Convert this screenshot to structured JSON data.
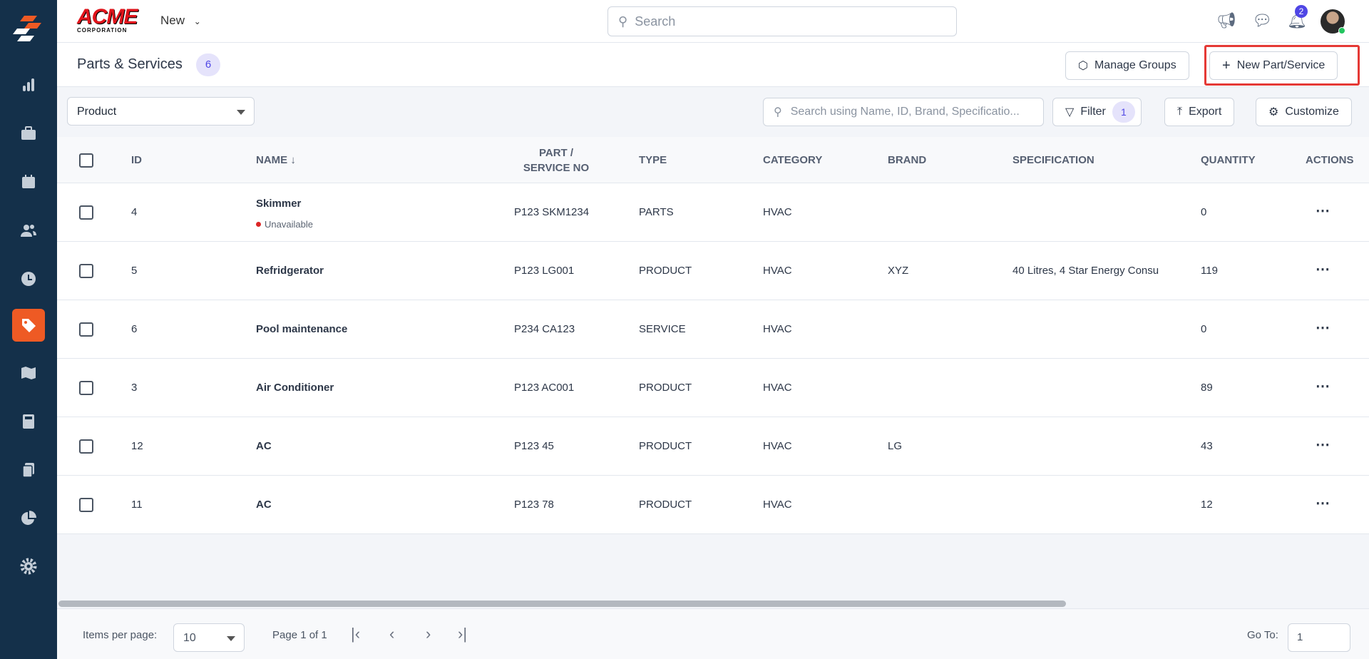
{
  "app": {
    "logo_text": "ACME",
    "logo_sub": "CORPORATION",
    "new_label": "New",
    "search_placeholder": "Search",
    "notification_count": "2"
  },
  "page": {
    "title": "Parts & Services",
    "count": "6",
    "manage_groups": "Manage Groups",
    "new_part": "New Part/Service"
  },
  "toolbar": {
    "select_value": "Product",
    "search_placeholder": "Search using Name, ID, Brand, Specificatio...",
    "filter": "Filter",
    "filter_count": "1",
    "export": "Export",
    "customize": "Customize"
  },
  "table": {
    "headers": {
      "id": "ID",
      "name": "NAME",
      "part1": "PART /",
      "part2": "SERVICE NO",
      "type": "TYPE",
      "category": "CATEGORY",
      "brand": "BRAND",
      "spec": "SPECIFICATION",
      "quantity": "QUANTITY",
      "actions": "ACTIONS"
    },
    "rows": [
      {
        "id": "4",
        "name": "Skimmer",
        "status": "Unavailable",
        "part": "P123 SKM1234",
        "type": "PARTS",
        "category": "HVAC",
        "brand": "",
        "spec": "",
        "quantity": "0"
      },
      {
        "id": "5",
        "name": "Refridgerator",
        "status": "",
        "part": "P123 LG001",
        "type": "PRODUCT",
        "category": "HVAC",
        "brand": "XYZ",
        "spec": "40 Litres, 4 Star Energy Consu",
        "quantity": "119"
      },
      {
        "id": "6",
        "name": "Pool maintenance",
        "status": "",
        "part": "P234 CA123",
        "type": "SERVICE",
        "category": "HVAC",
        "brand": "",
        "spec": "",
        "quantity": "0"
      },
      {
        "id": "3",
        "name": "Air Conditioner",
        "status": "",
        "part": "P123 AC001",
        "type": "PRODUCT",
        "category": "HVAC",
        "brand": "",
        "spec": "",
        "quantity": "89"
      },
      {
        "id": "12",
        "name": "AC",
        "status": "",
        "part": "P123 45",
        "type": "PRODUCT",
        "category": "HVAC",
        "brand": "LG",
        "spec": "",
        "quantity": "43"
      },
      {
        "id": "11",
        "name": "AC",
        "status": "",
        "part": "P123 78",
        "type": "PRODUCT",
        "category": "HVAC",
        "brand": "",
        "spec": "",
        "quantity": "12"
      }
    ]
  },
  "footer": {
    "items_per_page_label": "Items per page:",
    "items_per_page": "10",
    "page_info": "Page 1 of 1",
    "goto_label": "Go To:",
    "goto_value": "1"
  }
}
